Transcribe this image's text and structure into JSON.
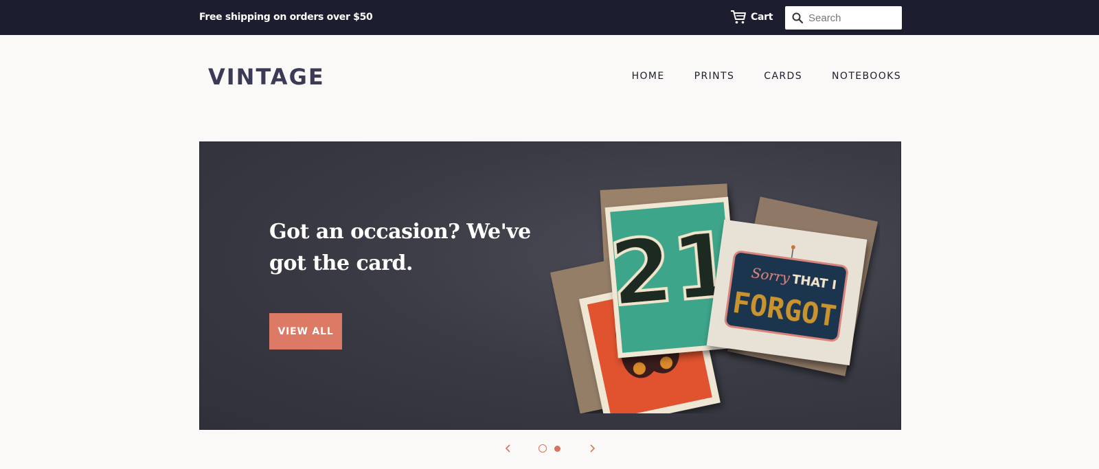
{
  "announcement": {
    "text": "Free shipping on orders over $50"
  },
  "topbar": {
    "cart_label": "Cart",
    "cart_icon": "cart-icon",
    "search_placeholder": "Search",
    "search_value": "",
    "search_icon": "search-icon"
  },
  "header": {
    "logo": "VINTAGE",
    "nav": [
      {
        "label": "HOME"
      },
      {
        "label": "PRINTS"
      },
      {
        "label": "CARDS"
      },
      {
        "label": "NOTEBOOKS"
      }
    ]
  },
  "hero": {
    "title": "Got an occasion? We've got the card.",
    "button_label": "VIEW ALL",
    "card_texts": {
      "number": "21",
      "script": "Sorry",
      "that_i": "THAT I",
      "forgot": "FORGOT"
    }
  },
  "slider": {
    "prev_icon": "chevron-left-icon",
    "next_icon": "chevron-right-icon",
    "slide_count": 2,
    "active_slide": 1
  },
  "colors": {
    "topbar_bg": "#1c1d2e",
    "accent": "#dd7a66",
    "logo": "#3c3b55",
    "page_bg": "#fbf9f7"
  }
}
